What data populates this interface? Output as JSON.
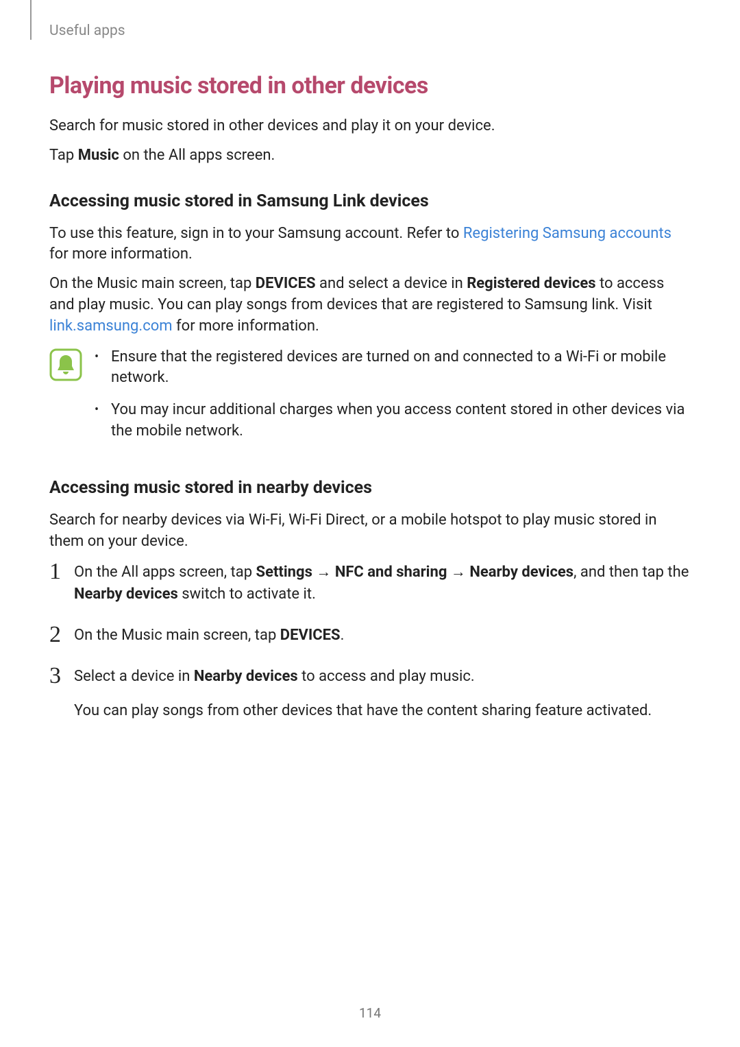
{
  "header": {
    "section": "Useful apps"
  },
  "main_heading": "Playing music stored in other devices",
  "intro": {
    "p1": "Search for music stored in other devices and play it on your device.",
    "p2_pre": "Tap ",
    "p2_bold": "Music",
    "p2_post": " on the All apps screen."
  },
  "section1": {
    "heading": "Accessing music stored in Samsung Link devices",
    "p1_pre": "To use this feature, sign in to your Samsung account. Refer to ",
    "p1_link": "Registering Samsung accounts",
    "p1_post": " for more information.",
    "p2_pre": "On the Music main screen, tap ",
    "p2_b1": "DEVICES",
    "p2_mid1": " and select a device in ",
    "p2_b2": "Registered devices",
    "p2_mid2": " to access and play music. You can play songs from devices that are registered to Samsung link. Visit ",
    "p2_link": "link.samsung.com",
    "p2_post": " for more information."
  },
  "notes": {
    "item1": "Ensure that the registered devices are turned on and connected to a Wi-Fi or mobile network.",
    "item2": "You may incur additional charges when you access content stored in other devices via the mobile network."
  },
  "section2": {
    "heading": "Accessing music stored in nearby devices",
    "p1": "Search for nearby devices via Wi-Fi, Wi-Fi Direct, or a mobile hotspot to play music stored in them on your device.",
    "step1_pre": "On the All apps screen, tap ",
    "step1_b1": "Settings",
    "step1_arr1": " → ",
    "step1_b2": "NFC and sharing",
    "step1_arr2": " → ",
    "step1_b3": "Nearby devices",
    "step1_mid": ", and then tap the ",
    "step1_b4": "Nearby devices",
    "step1_post": " switch to activate it.",
    "step2_pre": "On the Music main screen, tap ",
    "step2_b1": "DEVICES",
    "step2_post": ".",
    "step3_pre": "Select a device in ",
    "step3_b1": "Nearby devices",
    "step3_post": " to access and play music.",
    "step3_p2": "You can play songs from other devices that have the content sharing feature activated."
  },
  "page_number": "114"
}
